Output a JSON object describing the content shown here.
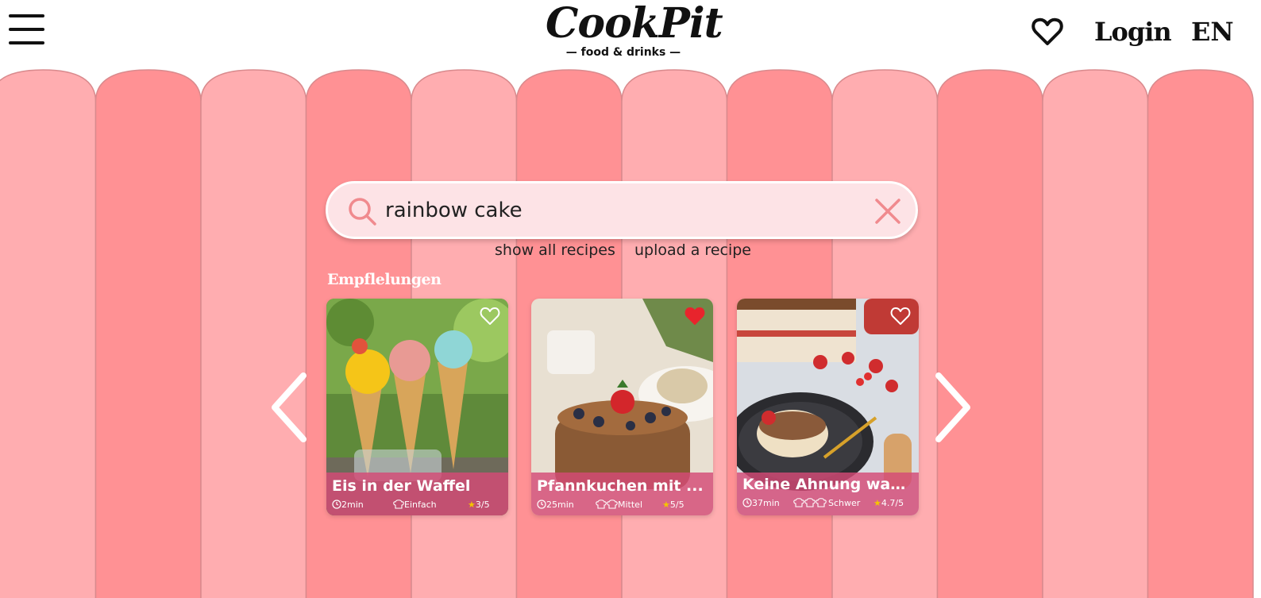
{
  "header": {
    "logo_title": "CookPit",
    "logo_subtitle": "— food & drinks —",
    "login_label": "Login",
    "language": "EN"
  },
  "search": {
    "value": "rainbow cake",
    "placeholder": ""
  },
  "links": {
    "show_all": "show all recipes",
    "upload": "upload a recipe"
  },
  "recommendations": {
    "title": "Empflelungen",
    "cards": [
      {
        "title": "Eis in der Waffel",
        "time": "2min",
        "difficulty": "Einfach",
        "rating": "3/5",
        "favorited": false
      },
      {
        "title": "Pfannkuchen mit ...",
        "time": "25min",
        "difficulty": "Mittel",
        "rating": "5/5",
        "favorited": true
      },
      {
        "title": "Keine Ahnung was ...",
        "time": "37min",
        "difficulty": "Schwer",
        "rating": "4.7/5",
        "favorited": false
      }
    ]
  },
  "colors": {
    "stripe_light": "#ffadb0",
    "stripe_dark": "#ff9194",
    "card_footer": "#d44a76",
    "star": "#f5c400",
    "heart_active": "#e8242c"
  }
}
